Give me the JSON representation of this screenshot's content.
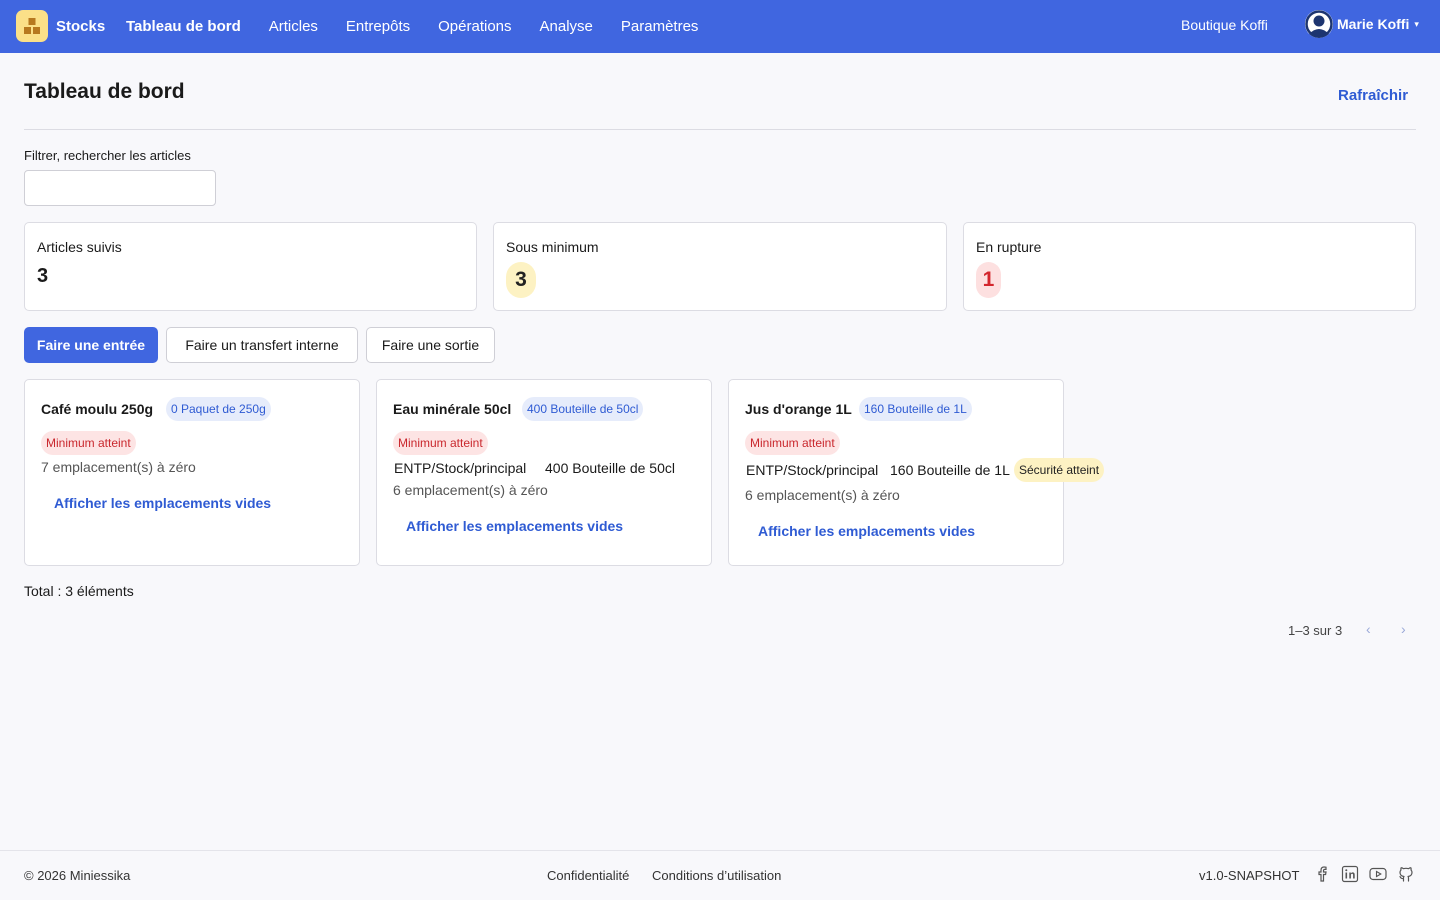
{
  "nav": {
    "brand": "Stocks",
    "items": [
      {
        "label": "Tableau de bord",
        "active": true
      },
      {
        "label": "Articles"
      },
      {
        "label": "Entrepôts"
      },
      {
        "label": "Opérations"
      },
      {
        "label": "Analyse"
      },
      {
        "label": "Paramètres"
      }
    ],
    "shop": "Boutique Koffi",
    "user": "Marie Koffi",
    "user_caret": "▾"
  },
  "header": {
    "title": "Tableau de bord",
    "refresh": "Rafraîchir"
  },
  "filter": {
    "label": "Filtrer, rechercher les articles",
    "value": "",
    "placeholder": ""
  },
  "stats": [
    {
      "label": "Articles suivis",
      "value": "3"
    },
    {
      "label": "Sous minimum",
      "value": "3"
    },
    {
      "label": "En rupture",
      "value": "1"
    }
  ],
  "actions": {
    "entry": "Faire une entrée",
    "transfer": "Faire un transfert interne",
    "exit": "Faire une sortie"
  },
  "cards": [
    {
      "title": "Café moulu 250g",
      "qty": "0 Paquet de 250g",
      "status": "Minimum atteint",
      "zero": "7 emplacement(s) à zéro",
      "link": "Afficher les emplacements vides"
    },
    {
      "title": "Eau minérale 50cl",
      "qty": "400 Bouteille de 50cl",
      "status": "Minimum atteint",
      "location": "ENTP/Stock/principal",
      "location_qty": "400 Bouteille de 50cl",
      "zero": "6 emplacement(s) à zéro",
      "link": "Afficher les emplacements vides"
    },
    {
      "title": "Jus d'orange 1L",
      "qty": "160 Bouteille de 1L",
      "status": "Minimum atteint",
      "location": "ENTP/Stock/principal",
      "location_qty": "160 Bouteille de 1L",
      "location_badge": "Sécurité atteint",
      "zero": "6 emplacement(s) à zéro",
      "link": "Afficher les emplacements vides"
    }
  ],
  "total": "Total : 3 éléments",
  "pagination": {
    "text": "1–3 sur 3",
    "prev": "‹",
    "next": "›"
  },
  "footer": {
    "copyright": "© 2026 Miniessika",
    "privacy": "Confidentialité",
    "terms": "Conditions d’utilisation",
    "version": "v1.0-SNAPSHOT"
  },
  "colors": {
    "accent": "#4066e0",
    "link": "#2f5bd3",
    "danger": "#d3262d",
    "warning_bg": "#fdf2c3"
  }
}
